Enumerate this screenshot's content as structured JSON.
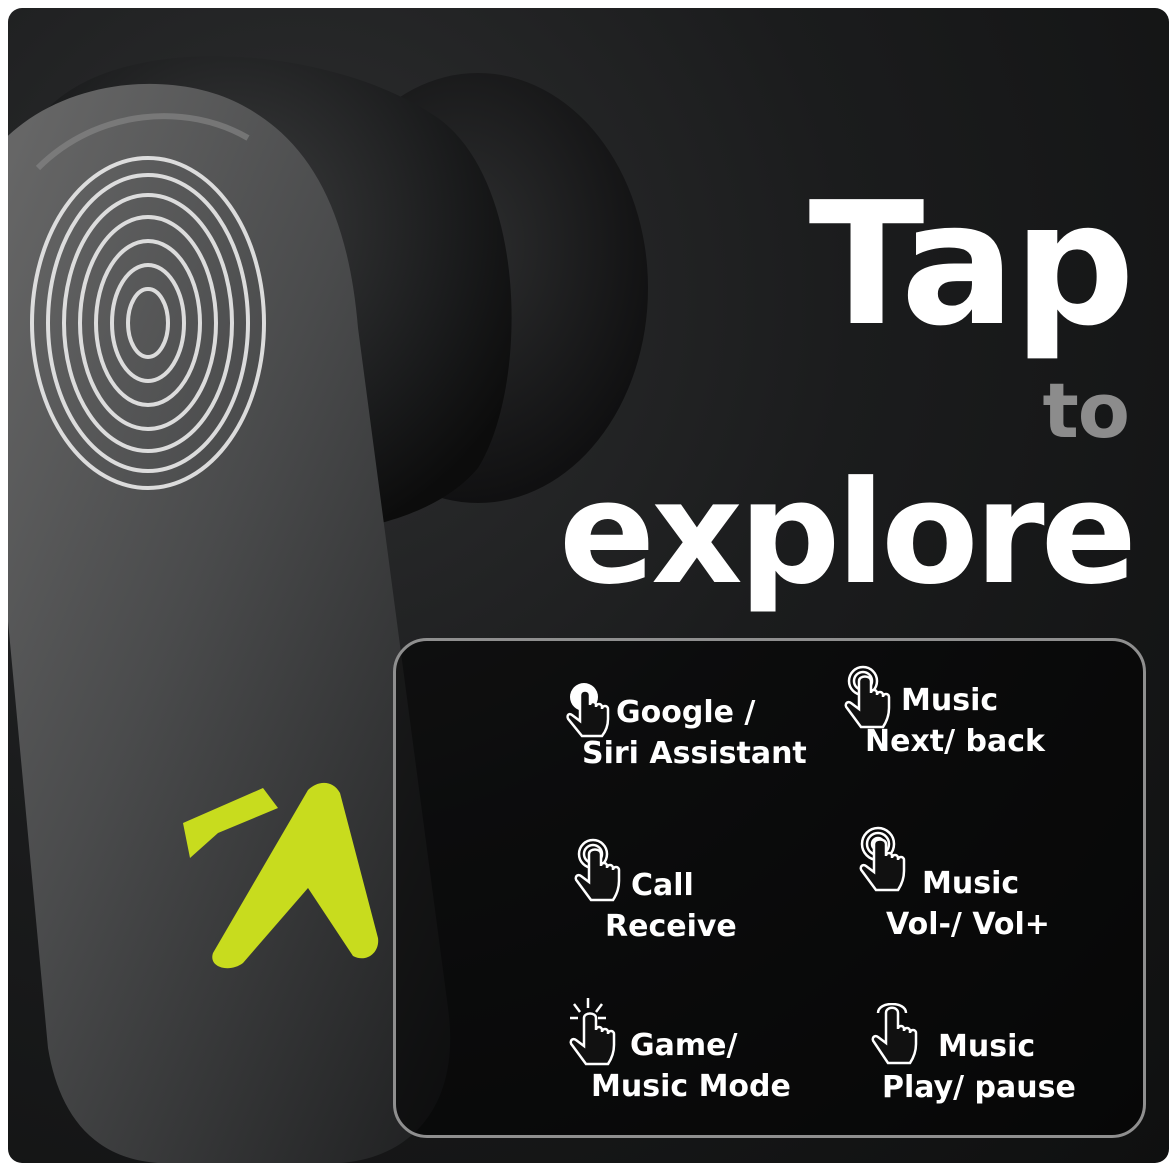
{
  "headline": {
    "line1": "Tap",
    "line2": "to",
    "line3": "explore"
  },
  "colors": {
    "brand_accent": "#c8dc1e",
    "panel_border": "#8f8f8f",
    "muted_text": "#8c8c8c"
  },
  "gestures": [
    {
      "icon": "single-tap-hand-icon",
      "line1": "Google /",
      "line2": "Siri Assistant"
    },
    {
      "icon": "double-tap-hand-icon",
      "line1": "Music",
      "line2": "Next/ back"
    },
    {
      "icon": "double-tap-hand-icon",
      "line1": "Call",
      "line2": "Receive"
    },
    {
      "icon": "triple-tap-hand-icon",
      "line1": "Music",
      "line2": "Vol-/ Vol+"
    },
    {
      "icon": "press-hold-hand-icon",
      "line1": "Game/",
      "line2": "Music Mode"
    },
    {
      "icon": "tap-hand-icon",
      "line1": "Music",
      "line2": "Play/ pause"
    }
  ]
}
